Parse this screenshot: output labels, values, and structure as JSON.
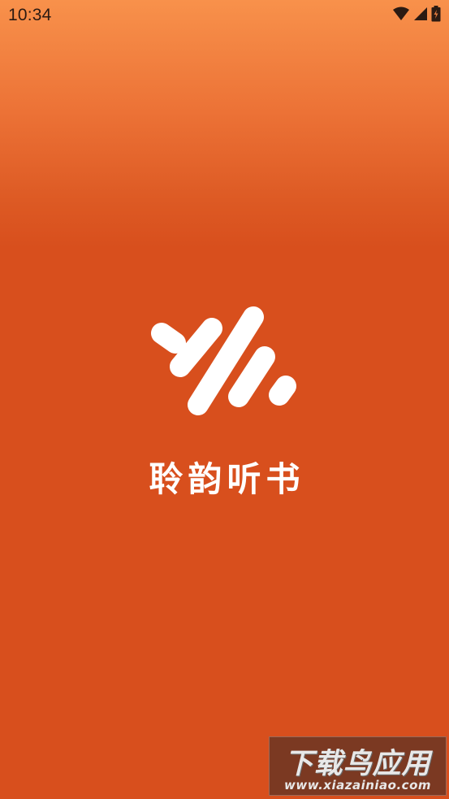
{
  "status_bar": {
    "time": "10:34",
    "icons": [
      "wifi-icon",
      "signal-icon",
      "battery-charging-icon"
    ]
  },
  "splash": {
    "logo_icon": "sound-wave-logo-icon",
    "app_name": "聆韵听书"
  },
  "watermark": {
    "title": "下载鸟应用",
    "url": "www.xiazainiao.com"
  },
  "colors": {
    "background_top": "#f8914b",
    "background_main": "#d84f1d",
    "logo": "#ffffff",
    "status_text": "#2b1a12"
  }
}
